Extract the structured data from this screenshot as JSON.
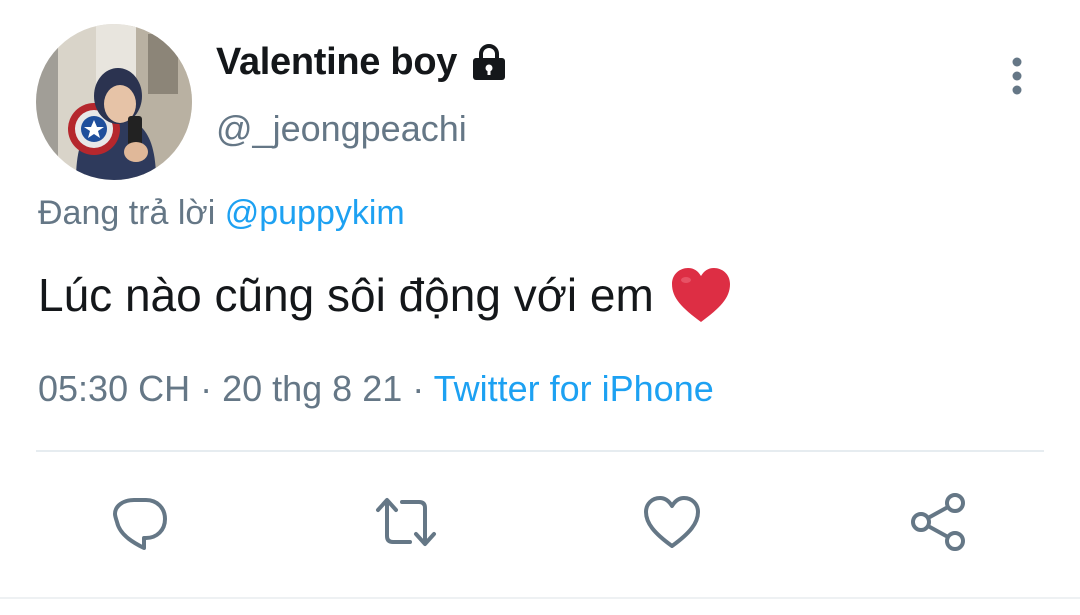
{
  "tweet": {
    "author": {
      "display_name": "Valentine boy",
      "handle": "@_jeongpeachi"
    },
    "reply_context": {
      "prefix": "Đang trả lời ",
      "mention": "@puppykim"
    },
    "text": "Lúc nào cũng sôi động với em",
    "emoji": "red-heart",
    "meta": {
      "time": "05:30 CH",
      "separator1": " · ",
      "date": "20 thg 8 21",
      "separator2": " · ",
      "source": "Twitter for iPhone"
    }
  },
  "icons": {
    "lock": "lock-icon",
    "more": "more-vertical-icon",
    "reply": "reply-icon",
    "retweet": "retweet-icon",
    "like": "heart-icon",
    "share": "share-icon"
  },
  "colors": {
    "text": "#14171a",
    "secondary": "#657786",
    "link": "#1da1f2",
    "divider": "#e6ecf0"
  }
}
